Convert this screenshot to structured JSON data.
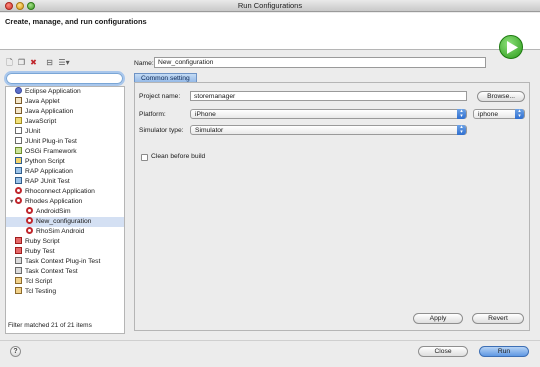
{
  "window": {
    "title": "Run Configurations"
  },
  "banner": {
    "title": "Create, manage, and run configurations",
    "run_badge_icon": "run-icon",
    "accent": "#2b9b1a"
  },
  "toolbar": {
    "icons": [
      "new-config-icon",
      "duplicate-icon",
      "delete-icon",
      "collapse-all-icon",
      "filter-icon"
    ]
  },
  "filter": {
    "value": "",
    "placeholder": "",
    "status": "Filter matched 21 of 21 items"
  },
  "tree": {
    "items": [
      {
        "label": "Eclipse Application",
        "icon": "eclipse"
      },
      {
        "label": "Java Applet",
        "icon": "java"
      },
      {
        "label": "Java Application",
        "icon": "java"
      },
      {
        "label": "JavaScript",
        "icon": "js"
      },
      {
        "label": "JUnit",
        "icon": "junit"
      },
      {
        "label": "JUnit Plug-in Test",
        "icon": "junit"
      },
      {
        "label": "OSGi Framework",
        "icon": "osgi"
      },
      {
        "label": "Python Script",
        "icon": "python"
      },
      {
        "label": "RAP Application",
        "icon": "rap"
      },
      {
        "label": "RAP JUnit Test",
        "icon": "rap"
      },
      {
        "label": "Rhoconnect Application",
        "icon": "rho"
      },
      {
        "label": "Rhodes Application",
        "icon": "rho",
        "expanded": true
      },
      {
        "label": "AndroidSim",
        "icon": "rho",
        "child": true
      },
      {
        "label": "New_configuration",
        "icon": "rho",
        "child": true,
        "selected": true
      },
      {
        "label": "RhoSim Android",
        "icon": "rho",
        "child": true
      },
      {
        "label": "Ruby Script",
        "icon": "ruby"
      },
      {
        "label": "Ruby Test",
        "icon": "ruby"
      },
      {
        "label": "Task Context Plug-in Test",
        "icon": "task"
      },
      {
        "label": "Task Context Test",
        "icon": "task"
      },
      {
        "label": "Tcl Script",
        "icon": "tcl"
      },
      {
        "label": "Tcl Testing",
        "icon": "tcl"
      }
    ]
  },
  "config": {
    "name_label": "Name:",
    "name_value": "New_configuration",
    "tab_label": "Common setting",
    "project_label": "Project name:",
    "project_value": "storemanager",
    "browse_label": "Browse...",
    "platform_label": "Platform:",
    "platform_value": "iPhone",
    "device_value": "iphone",
    "simulator_label": "Simulator type:",
    "simulator_value": "Simulator",
    "clean_label": "Clean before build",
    "clean_checked": false,
    "apply_label": "Apply",
    "revert_label": "Revert"
  },
  "footer": {
    "help_label": "?",
    "close_label": "Close",
    "run_label": "Run"
  }
}
